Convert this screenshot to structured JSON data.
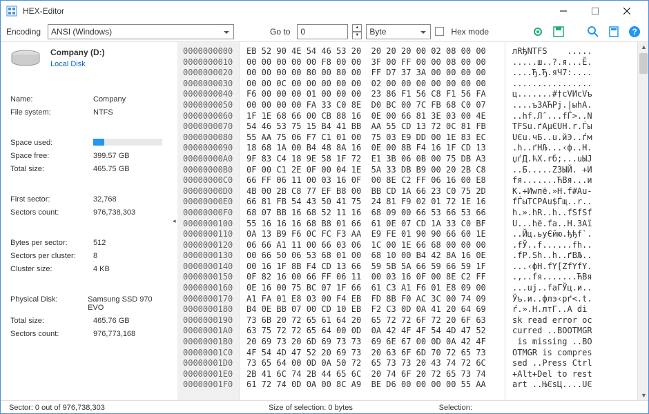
{
  "window": {
    "title": "HEX-Editor"
  },
  "toolbar": {
    "encoding_label": "Encoding",
    "encoding_value": "ANSI (Windows)",
    "goto_label": "Go to",
    "goto_value": "0",
    "unit_value": "Byte",
    "hexmode_label": "Hex mode"
  },
  "disk": {
    "name": "Company (D:)",
    "sub": "Local Disk"
  },
  "props": {
    "name_k": "Name:",
    "name_v": "Company",
    "fs_k": "File system:",
    "fs_v": "NTFS",
    "used_k": "Space used:",
    "free_k": "Space free:",
    "free_v": "399.57 GB",
    "tot_k": "Total size:",
    "tot_v": "465.75 GB",
    "fsec_k": "First sector:",
    "fsec_v": "32,768",
    "scount_k": "Sectors count:",
    "scount_v": "976,738,303",
    "bps_k": "Bytes per sector:",
    "bps_v": "512",
    "spc_k": "Sectors per cluster:",
    "spc_v": "8",
    "cs_k": "Cluster size:",
    "cs_v": "4 KB",
    "pd_k": "Physical Disk:",
    "pd_v": "Samsung SSD 970 EVO",
    "ptot_k": "Total size:",
    "ptot_v": "465.76 GB",
    "psc_k": "Sectors count:",
    "psc_v": "976,773,168"
  },
  "hex": {
    "offsets": "0000000000\n0000000010\n0000000020\n0000000030\n0000000040\n0000000050\n0000000060\n0000000070\n0000000080\n0000000090\n00000000A0\n00000000B0\n00000000C0\n00000000D0\n00000000E0\n00000000F0\n0000000100\n0000000110\n0000000120\n0000000130\n0000000140\n0000000150\n0000000160\n0000000170\n0000000180\n0000000190\n00000001A0\n00000001B0\n00000001C0\n00000001D0\n00000001E0\n00000001F0",
    "bytes": "EB 52 90 4E 54 46 53 20  20 20 20 00 02 08 00 00\n00 00 00 00 00 F8 00 00  3F 00 FF 00 00 08 00 00\n00 00 00 00 80 00 80 00  FF D7 37 3A 00 00 00 00\n00 00 0C 00 00 00 00 00  02 00 00 00 00 00 00 00\nF6 00 00 00 01 00 00 00  23 86 F1 56 C8 F1 56 FA\n00 00 00 00 FA 33 C0 8E  D0 BC 00 7C FB 68 C0 07\n1F 1E 68 66 00 CB 88 16  0E 00 66 81 3E 03 00 4E\n54 46 53 75 15 B4 41 BB  AA 55 CD 13 72 0C 81 FB\n55 AA 75 06 F7 C1 01 00  75 03 E9 DD 00 1E 83 EC\n18 68 1A 00 B4 48 8A 16  0E 00 8B F4 16 1F CD 13\n9F 83 C4 18 9E 58 1F 72  E1 3B 06 0B 00 75 DB A3\n0F 00 C1 2E 0F 00 04 1E  5A 33 DB B9 00 20 2B C8\n66 FF 06 11 00 03 16 0F  00 8E C2 FF 06 16 00 E8\n4B 00 2B C8 77 EF B8 00  BB CD 1A 66 23 C0 75 2D\n66 81 FB 54 43 50 41 75  24 81 F9 02 01 72 1E 16\n68 07 BB 16 68 52 11 16  68 09 00 66 53 66 53 66\n55 16 16 16 68 B8 01 66  61 0E 07 CD 1A 33 C0 BF\n0A 13 B9 F6 0C FC F3 AA  E9 FE 01 90 90 66 60 1E\n06 66 A1 11 00 66 03 06  1C 00 1E 66 68 00 00 00\n00 66 50 06 53 68 01 00  68 10 00 B4 42 8A 16 0E\n00 16 1F 8B F4 CD 13 66  59 5B 5A 66 59 66 59 1F\n0F 82 16 00 66 FF 06 11  00 03 16 0F 00 8E C2 FF\n0E 16 00 75 BC 07 1F 66  61 C3 A1 F6 01 E8 09 00\nA1 FA 01 E8 03 00 F4 EB  FD 8B F0 AC 3C 00 74 09\nB4 0E BB 07 00 CD 10 EB  F2 C3 0D 0A 41 20 64 69\n73 6B 20 72 65 61 64 20  65 72 72 6F 72 20 6F 63\n63 75 72 72 65 64 00 0D  0A 42 4F 4F 54 4D 47 52\n20 69 73 20 6D 69 73 73  69 6E 67 00 0D 0A 42 4F\n4F 54 4D 47 52 20 69 73  20 63 6F 6D 70 72 65 73\n73 65 64 00 0D 0A 50 72  65 73 73 20 43 74 72 6C\n2B 41 6C 74 2B 44 65 6C  20 74 6F 20 72 65 73 74\n61 72 74 0D 0A 00 8C A9  BE D6 00 00 00 00 55 AA",
    "ascii": "лRђNTFS    .....\n.....ш..?.я...Ё.\n....Ђ.Ђ.яЧ7:....\n................\nц.......#†сVИсVъ\n....ъ3АЋРј.|ыhА.\n..hf.Лˆ...fЃ>..N\nTFSu.ґAµЄUН.r.Ѓы\nUЄu.чБ..u.йЭ..ѓм\n.h..ґHЉ...‹ф..Н.\nџѓД.ћX.rб;...uЫЈ\n..Б.....Z3ЫЙ. +И\nfя.......ЋВя...и\nK.+Иwпё.»Н.f#Аu-\nfЃыTCPAu$Ѓщ..r..\nh.».hR..h..fSfSf\nU...hё.fa..Н.3Аї\n..Йц.ьуЄйю.ђђf`.\n.fЎ..f......fh..\n.fP.Sh..h..ґBЉ..\n...‹фН.fY[ZfYfY.\n.‚..fя.......ЋВя\n...uј..faГЎц.и..\nЎъ.и..флэ‹рґ<.t.\nŕ.».Н.лтГ..A di\nsk read error oc\ncurred ..BOOTMGR\n is missing ..BO\nOTMGR is compres\nsed ..Press Ctrl\n+Alt+Del to rest\nart ..ЊЄѕЦ....UЄ"
  },
  "status": {
    "sector": "Sector: 0 out of 976,738,303",
    "sel": "Size of selection: 0 bytes",
    "selection": "Selection:"
  }
}
